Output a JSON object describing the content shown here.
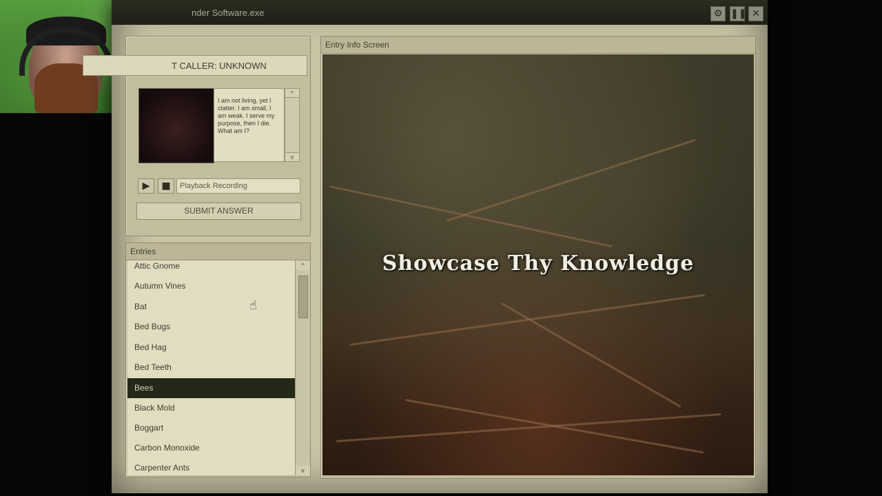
{
  "window": {
    "title": "nder Software.exe",
    "controls": [
      "gear-icon",
      "pause-icon",
      "close-icon"
    ]
  },
  "caller": {
    "caller_id_label": "T CALLER: UNKNOWN",
    "riddle": "I am not living, yet I clatter. I am small, I am weak. I serve my purpose, then I die. What am I?",
    "scroll_up": "^",
    "scroll_down": "v",
    "play_icon": "▶",
    "stop_icon": "■",
    "playback_label": "Playback Recording",
    "submit_label": "SUBMIT ANSWER"
  },
  "entries": {
    "header": "Entries",
    "selected": "Bees",
    "items": [
      "Attic Gnome",
      "Autumn Vines",
      "Bat",
      "Bed Bugs",
      "Bed Hag",
      "Bed Teeth",
      "Bees",
      "Black Mold",
      "Boggart",
      "Carbon Monoxide",
      "Carpenter Ants"
    ],
    "scroll_up": "^",
    "scroll_down": "v"
  },
  "info": {
    "header": "Entry Info Screen",
    "banner": "Showcase Thy Knowledge"
  },
  "colors": {
    "panel": "#c2bd9d",
    "selection": "#242818",
    "titlebar": "#1d2017"
  }
}
